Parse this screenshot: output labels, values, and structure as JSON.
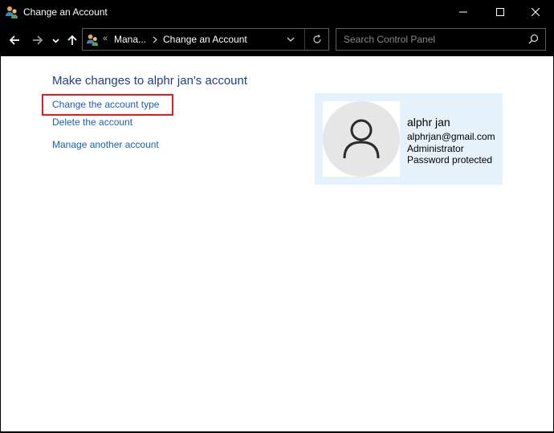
{
  "window": {
    "title": "Change an Account",
    "controls": [
      "minimize",
      "maximize",
      "close"
    ]
  },
  "nav": {
    "back_icon": "arrow-left-icon",
    "forward_icon": "arrow-right-icon",
    "recent_icon": "chevron-down-icon",
    "up_icon": "arrow-up-icon"
  },
  "address": {
    "overflow": "«",
    "crumbs": [
      "Mana...",
      "Change an Account"
    ],
    "refresh_icon": "refresh-icon"
  },
  "search": {
    "placeholder": "Search Control Panel",
    "value": ""
  },
  "main": {
    "heading": "Make changes to alphr jan's account",
    "links": {
      "change_type": "Change the account type",
      "delete": "Delete the account",
      "manage_other": "Manage another account"
    }
  },
  "account": {
    "name": "alphr jan",
    "email": "alphrjan@gmail.com",
    "role": "Administrator",
    "status": "Password protected"
  },
  "colors": {
    "link": "#1a5fb4",
    "heading": "#1e3f8f",
    "highlight": "#e31b1b",
    "card_bg": "#e5f1fb"
  }
}
